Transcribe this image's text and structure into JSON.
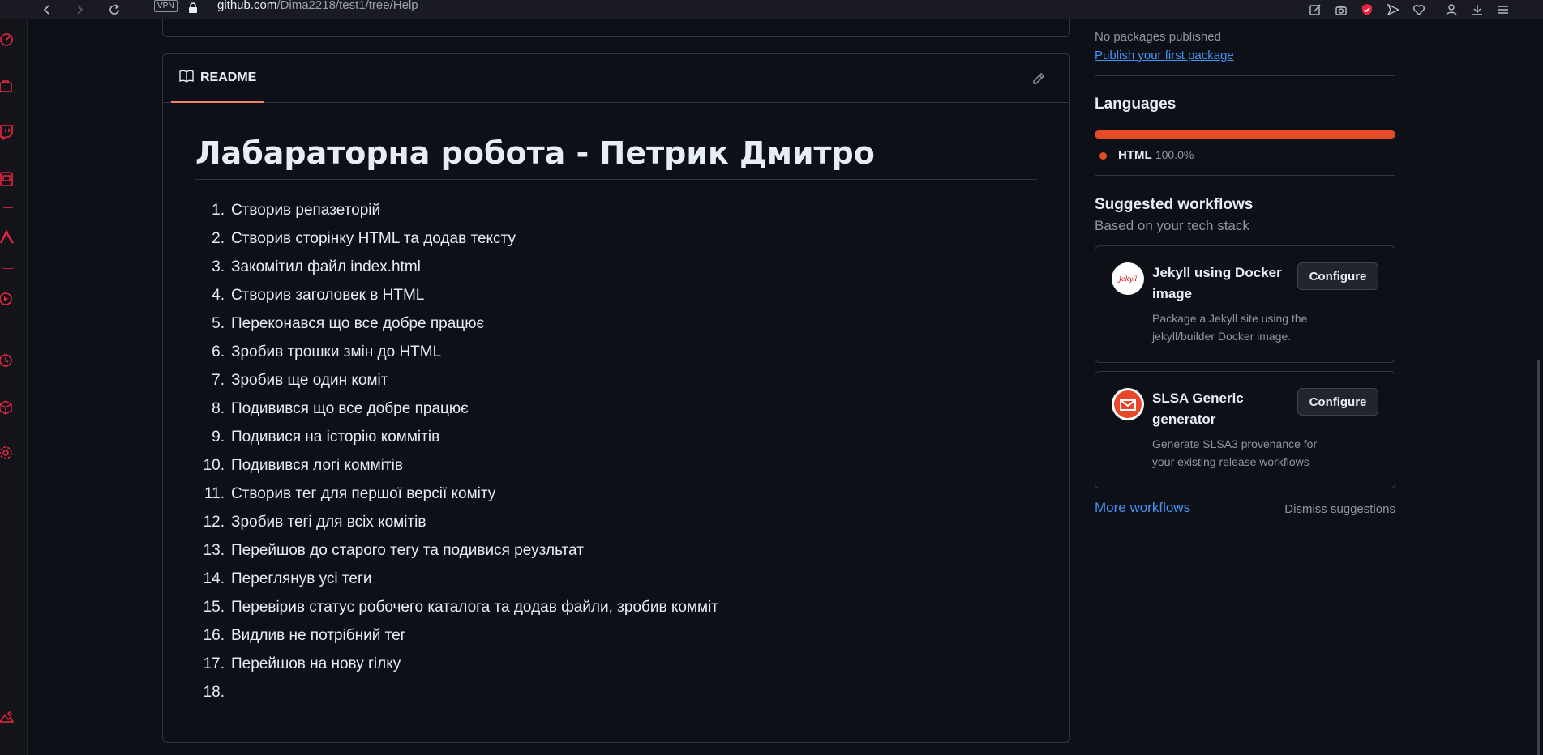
{
  "browser": {
    "vpn_label": "VPN",
    "url_host": "github.com",
    "url_path": "/Dima2218/test1/tree/Help"
  },
  "readme": {
    "tab_label": "README",
    "title": "Лабараторна робота - Петрик Дмитро",
    "steps": [
      {
        "num": "1.",
        "text": "Створив репазеторій"
      },
      {
        "num": "2.",
        "text": "Створив сторінку HTML та додав тексту"
      },
      {
        "num": "3.",
        "text": "Закомітил файл index.html"
      },
      {
        "num": "4.",
        "text": "Створив заголовек в HTML"
      },
      {
        "num": "5.",
        "text": "Переконався що все добре працює"
      },
      {
        "num": "6.",
        "text": "Зробив трошки змін до HTML"
      },
      {
        "num": "7.",
        "text": "Зробив ще один коміт"
      },
      {
        "num": "8.",
        "text": "Подивився що все добре працює"
      },
      {
        "num": "9.",
        "text": "Подивися на історію коммітів"
      },
      {
        "num": "10.",
        "text": "Подивився логі коммітів"
      },
      {
        "num": "11.",
        "text": "Створив тег для першої версії коміту"
      },
      {
        "num": "12.",
        "text": "Зробив тегі для всіх комітів"
      },
      {
        "num": "13.",
        "text": "Перейшов до старого тегу та подивися реузльтат"
      },
      {
        "num": "14.",
        "text": "Переглянув усі теги"
      },
      {
        "num": "15.",
        "text": "Перевірив статус робочего каталога та додав файли, зробив комміт"
      },
      {
        "num": "16.",
        "text": "Видлив не потрібний тег"
      },
      {
        "num": "17.",
        "text": "Перейшов на нову гілку"
      },
      {
        "num": "18.",
        "text": ""
      }
    ]
  },
  "packages": {
    "status": "No packages published",
    "publish_link": "Publish your first package"
  },
  "languages": {
    "heading": "Languages",
    "items": [
      {
        "name": "HTML",
        "percent": "100.0%",
        "fraction": 1.0,
        "color": "#e34c26"
      }
    ]
  },
  "workflows": {
    "heading": "Suggested workflows",
    "subheading": "Based on your tech stack",
    "items": [
      {
        "title": "Jekyll using Docker image",
        "description": "Package a Jekyll site using the jekyll/builder Docker image.",
        "button": "Configure",
        "logo_text": "Jekyll"
      },
      {
        "title": "SLSA Generic generator",
        "description": "Generate SLSA3 provenance for your existing release workflows",
        "button": "Configure"
      }
    ],
    "more_link": "More workflows",
    "dismiss": "Dismiss suggestions"
  },
  "colors": {
    "accent_tab": "#f78166",
    "link": "#4493f8",
    "opera_red": "#e8273f"
  }
}
